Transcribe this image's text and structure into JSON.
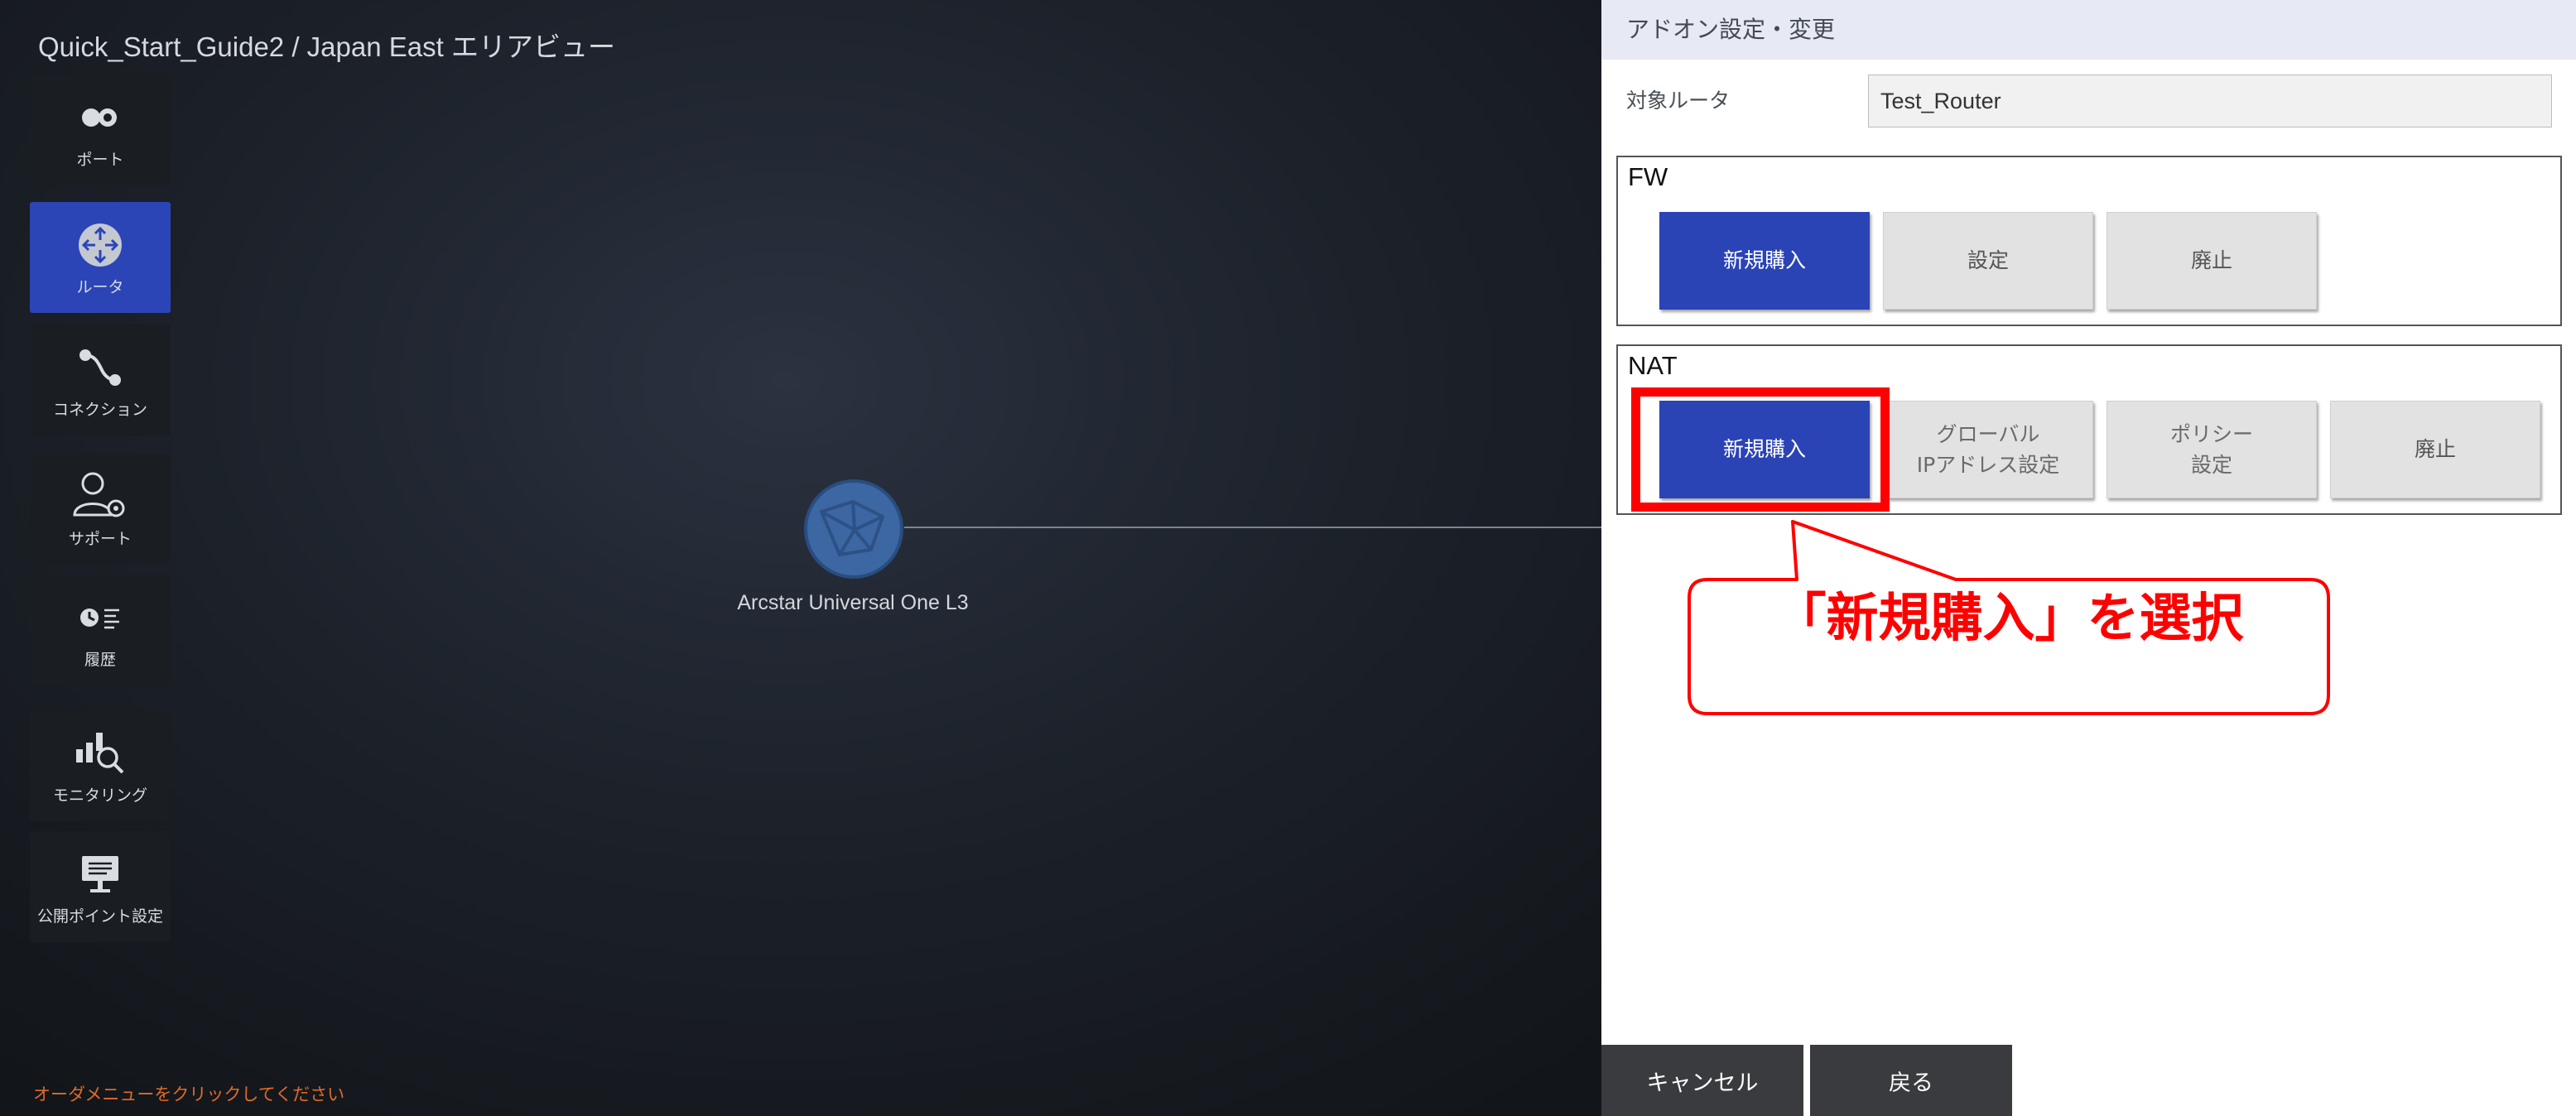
{
  "header": {
    "title": "Quick_Start_Guide2 / Japan East エリアビュー"
  },
  "sidebar": {
    "items": [
      {
        "label": "ポート",
        "icon": "port-icon"
      },
      {
        "label": "ルータ",
        "icon": "router-icon",
        "active": true
      },
      {
        "label": "コネクション",
        "icon": "connection-icon"
      },
      {
        "label": "サポート",
        "icon": "support-icon"
      },
      {
        "label": "履歴",
        "icon": "history-icon"
      },
      {
        "label": "モニタリング",
        "icon": "monitoring-icon"
      },
      {
        "label": "公開ポイント設定",
        "icon": "public-point-icon"
      }
    ]
  },
  "map": {
    "node_label": "Arcstar Universal One L3",
    "hint": "オーダメニューをクリックしてください"
  },
  "panel": {
    "title": "アドオン設定・変更",
    "target_label": "対象ルータ",
    "target_value": "Test_Router",
    "fw": {
      "title": "FW",
      "buttons": {
        "new": "新規購入",
        "settings": "設定",
        "abolish": "廃止"
      }
    },
    "nat": {
      "title": "NAT",
      "buttons": {
        "new": "新規購入",
        "global_ip": "グローバル\nIPアドレス設定",
        "policy": "ポリシー\n設定",
        "abolish": "廃止"
      }
    },
    "footer": {
      "cancel": "キャンセル",
      "back": "戻る"
    }
  },
  "annotation": {
    "callout": "「新規購入」を選択",
    "color": "#ff0000"
  },
  "colors": {
    "accent": "#2a44b6",
    "panel_header": "#e7e9f4",
    "hint": "#e06a2a"
  }
}
